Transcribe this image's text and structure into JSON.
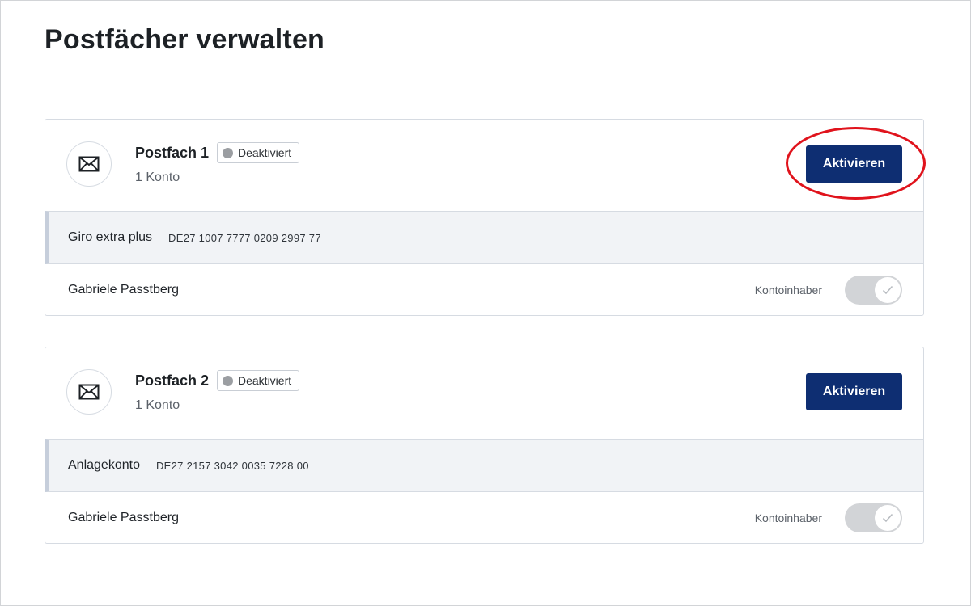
{
  "page": {
    "title": "Postfächer verwalten"
  },
  "mailboxes": [
    {
      "name": "Postfach 1",
      "status": "Deaktiviert",
      "account_count": "1 Konto",
      "action_label": "Aktivieren",
      "account": {
        "name": "Giro extra plus",
        "iban": "DE27 1007 7777 0209 2997 77"
      },
      "holder": {
        "name": "Gabriele Passtberg",
        "role": "Kontoinhaber",
        "toggle_checked": true
      }
    },
    {
      "name": "Postfach 2",
      "status": "Deaktiviert",
      "account_count": "1 Konto",
      "action_label": "Aktivieren",
      "account": {
        "name": "Anlagekonto",
        "iban": "DE27 2157 3042 0035 7228 00"
      },
      "holder": {
        "name": "Gabriele Passtberg",
        "role": "Kontoinhaber",
        "toggle_checked": true
      }
    }
  ],
  "colors": {
    "primary_button": "#0e2e72",
    "highlight_ring": "#e0131c",
    "status_dot": "#9b9ea2",
    "account_row_bg": "#f1f3f6"
  },
  "icons": {
    "mailbox": "envelope-icon",
    "status": "status-dot",
    "toggle": "check-icon"
  }
}
